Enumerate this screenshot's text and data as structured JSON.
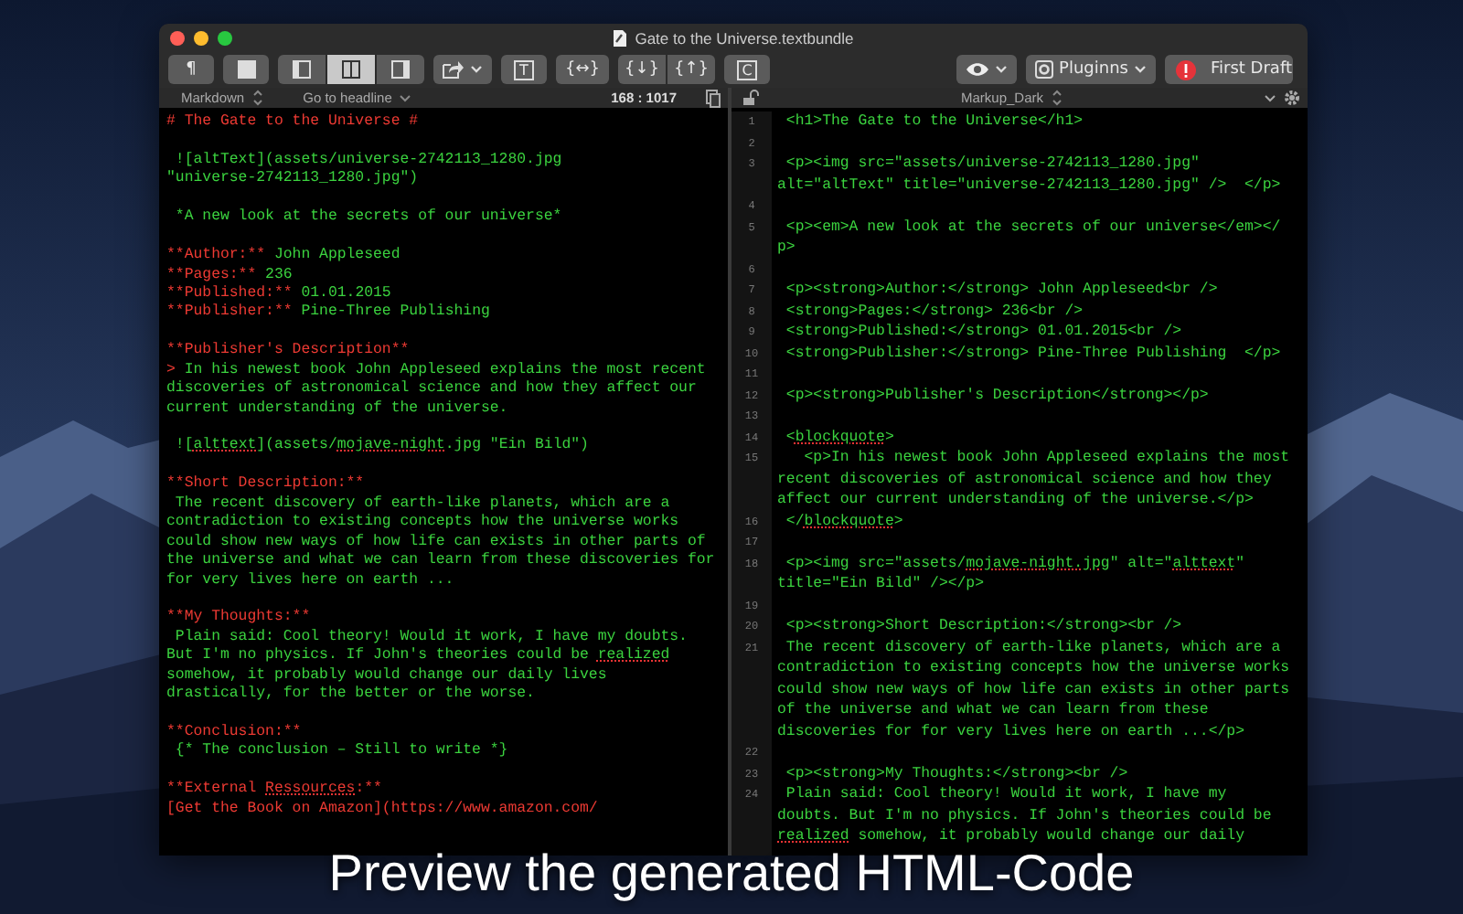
{
  "window": {
    "title": "Gate to the Universe.textbundle"
  },
  "toolbar": {
    "left": [
      {
        "kind": "text",
        "label": "¶"
      },
      {
        "kind": "single-pane"
      },
      {
        "kind": "layout",
        "options": [
          {
            "kind": "left",
            "selected": false
          },
          {
            "kind": "both",
            "selected": true
          },
          {
            "kind": "right",
            "selected": false
          }
        ]
      },
      {
        "kind": "share"
      },
      {
        "kind": "boxed",
        "label": "T"
      },
      {
        "kind": "text",
        "label": "{↔}"
      },
      {
        "kind": "pair",
        "labels": [
          "{↓}",
          "{↑}"
        ]
      },
      {
        "kind": "boxed",
        "label": "C"
      }
    ],
    "right": [
      {
        "kind": "preview"
      },
      {
        "kind": "menu",
        "label": "Pluginns"
      },
      {
        "kind": "status",
        "label": "First Draft"
      }
    ]
  },
  "left_header": {
    "mode": "Markdown",
    "navigator": "Go to headline",
    "position": "168 : 1017"
  },
  "right_header": {
    "theme": "Markup_Dark"
  },
  "editor": {
    "lines": [
      {
        "kind": "code",
        "segments": [
          {
            "kind": "markup",
            "text": "# The Gate to the Universe #"
          }
        ]
      },
      {
        "kind": "blank"
      },
      {
        "kind": "code",
        "segments": [
          {
            "kind": "text",
            "text": " ![altText](assets/universe-2742113_1280.jpg"
          }
        ]
      },
      {
        "kind": "code",
        "segments": [
          {
            "kind": "text",
            "text": "\"universe-2742113_1280.jpg\")"
          }
        ]
      },
      {
        "kind": "blank"
      },
      {
        "kind": "code",
        "segments": [
          {
            "kind": "text",
            "text": " *A new look at the secrets of our universe*"
          }
        ]
      },
      {
        "kind": "blank"
      },
      {
        "kind": "code",
        "segments": [
          {
            "kind": "markup",
            "text": "**Author:**"
          },
          {
            "kind": "text",
            "text": " John Appleseed"
          }
        ]
      },
      {
        "kind": "code",
        "segments": [
          {
            "kind": "markup",
            "text": "**Pages:**"
          },
          {
            "kind": "text",
            "text": " 236"
          }
        ]
      },
      {
        "kind": "code",
        "segments": [
          {
            "kind": "markup",
            "text": "**Published:**"
          },
          {
            "kind": "text",
            "text": " 01.01.2015"
          }
        ]
      },
      {
        "kind": "code",
        "segments": [
          {
            "kind": "markup",
            "text": "**Publisher:**"
          },
          {
            "kind": "text",
            "text": " Pine-Three Publishing"
          }
        ]
      },
      {
        "kind": "blank"
      },
      {
        "kind": "code",
        "segments": [
          {
            "kind": "markup",
            "text": "**Publisher's Description**"
          }
        ]
      },
      {
        "kind": "code",
        "segments": [
          {
            "kind": "markup",
            "text": ">"
          },
          {
            "kind": "text",
            "text": " In his newest book John Appleseed explains the most recent"
          }
        ]
      },
      {
        "kind": "code",
        "segments": [
          {
            "kind": "text",
            "text": "discoveries of astronomical science and how they affect our"
          }
        ]
      },
      {
        "kind": "code",
        "segments": [
          {
            "kind": "text",
            "text": "current understanding of the universe."
          }
        ]
      },
      {
        "kind": "blank"
      },
      {
        "kind": "code",
        "segments": [
          {
            "kind": "text",
            "text": " !["
          },
          {
            "kind": "typo",
            "text": "alttext"
          },
          {
            "kind": "text",
            "text": "](assets/"
          },
          {
            "kind": "typo",
            "text": "mojave-night"
          },
          {
            "kind": "text",
            "text": ".jpg \"Ein Bild\")"
          }
        ]
      },
      {
        "kind": "blank"
      },
      {
        "kind": "code",
        "segments": [
          {
            "kind": "markup",
            "text": "**Short Description:**"
          }
        ]
      },
      {
        "kind": "code",
        "segments": [
          {
            "kind": "text",
            "text": " The recent discovery of earth-like planets, which are a"
          }
        ]
      },
      {
        "kind": "code",
        "segments": [
          {
            "kind": "text",
            "text": "contradiction to existing concepts how the universe works"
          }
        ]
      },
      {
        "kind": "code",
        "segments": [
          {
            "kind": "text",
            "text": "could show new ways of how life can exists in other parts of"
          }
        ]
      },
      {
        "kind": "code",
        "segments": [
          {
            "kind": "text",
            "text": "the universe and what we can learn from these discoveries for"
          }
        ]
      },
      {
        "kind": "code",
        "segments": [
          {
            "kind": "text",
            "text": "for very lives here on earth ..."
          }
        ]
      },
      {
        "kind": "blank"
      },
      {
        "kind": "code",
        "segments": [
          {
            "kind": "markup",
            "text": "**My Thoughts:**"
          }
        ]
      },
      {
        "kind": "code",
        "segments": [
          {
            "kind": "text",
            "text": " Plain said: Cool theory! Would it work, I have my doubts."
          }
        ]
      },
      {
        "kind": "code",
        "segments": [
          {
            "kind": "text",
            "text": "But I'm no physics. If John's theories could be "
          },
          {
            "kind": "typo",
            "text": "realized"
          }
        ]
      },
      {
        "kind": "code",
        "segments": [
          {
            "kind": "text",
            "text": "somehow, it probably would change our daily lives"
          }
        ]
      },
      {
        "kind": "code",
        "segments": [
          {
            "kind": "text",
            "text": "drastically, for the better or the worse."
          }
        ]
      },
      {
        "kind": "blank"
      },
      {
        "kind": "code",
        "segments": [
          {
            "kind": "markup",
            "text": "**Conclusion:**"
          }
        ]
      },
      {
        "kind": "code",
        "segments": [
          {
            "kind": "text",
            "text": " {* The conclusion – Still to write *}"
          }
        ]
      },
      {
        "kind": "blank"
      },
      {
        "kind": "code",
        "segments": [
          {
            "kind": "markup",
            "text": "**External "
          },
          {
            "kind": "typo-markup",
            "text": "Ressources"
          },
          {
            "kind": "markup",
            "text": ":**"
          }
        ]
      },
      {
        "kind": "code",
        "segments": [
          {
            "kind": "markup",
            "text": "[Get the Book on Amazon](https://www.amazon.com/"
          }
        ]
      }
    ]
  },
  "preview": {
    "lines": [
      {
        "number": "1",
        "rows": [
          " <h1>The Gate to the Universe</h1>"
        ]
      },
      {
        "number": "2"
      },
      {
        "number": "3",
        "rows": [
          " <p><img src=\"assets/universe-2742113_1280.jpg\"",
          "alt=\"altText\" title=\"universe-2742113_1280.jpg\" />  </p>"
        ]
      },
      {
        "number": "4"
      },
      {
        "number": "5",
        "rows": [
          " <p><em>A new look at the secrets of our universe</em></",
          "p>"
        ]
      },
      {
        "number": "6"
      },
      {
        "number": "7",
        "rows": [
          " <p><strong>Author:</strong> John Appleseed<br />"
        ]
      },
      {
        "number": "8",
        "rows": [
          " <strong>Pages:</strong> 236<br />"
        ]
      },
      {
        "number": "9",
        "rows": [
          " <strong>Published:</strong> 01.01.2015<br />"
        ]
      },
      {
        "number": "10",
        "rows": [
          " <strong>Publisher:</strong> Pine-Three Publishing  </p>"
        ]
      },
      {
        "number": "11"
      },
      {
        "number": "12",
        "rows": [
          " <p><strong>Publisher's Description</strong></p>"
        ]
      },
      {
        "number": "13"
      },
      {
        "number": "14",
        "rows": [
          [
            {
              "kind": "text",
              "text": " <"
            },
            {
              "kind": "typo",
              "text": "blockquote"
            },
            {
              "kind": "text",
              "text": ">"
            }
          ]
        ]
      },
      {
        "number": "15",
        "rows": [
          "   <p>In his newest book John Appleseed explains the most",
          "recent discoveries of astronomical science and how they",
          "affect our current understanding of the universe.</p>"
        ]
      },
      {
        "number": "16",
        "rows": [
          [
            {
              "kind": "text",
              "text": " </"
            },
            {
              "kind": "typo",
              "text": "blockquote"
            },
            {
              "kind": "text",
              "text": ">"
            }
          ]
        ]
      },
      {
        "number": "17"
      },
      {
        "number": "18",
        "rows": [
          [
            {
              "kind": "text",
              "text": " <p><img src=\"assets/"
            },
            {
              "kind": "typo",
              "text": "mojave-night.jpg"
            },
            {
              "kind": "text",
              "text": "\" alt=\""
            },
            {
              "kind": "typo",
              "text": "alttext"
            },
            {
              "kind": "text",
              "text": "\""
            }
          ],
          "title=\"Ein Bild\" /></p>"
        ]
      },
      {
        "number": "19"
      },
      {
        "number": "20",
        "rows": [
          " <p><strong>Short Description:</strong><br />"
        ]
      },
      {
        "number": "21",
        "rows": [
          " The recent discovery of earth-like planets, which are a",
          "contradiction to existing concepts how the universe works",
          "could show new ways of how life can exists in other parts",
          "of the universe and what we can learn from these",
          "discoveries for for very lives here on earth ...</p>"
        ]
      },
      {
        "number": "22"
      },
      {
        "number": "23",
        "rows": [
          " <p><strong>My Thoughts:</strong><br />"
        ]
      },
      {
        "number": "24",
        "rows": [
          " Plain said: Cool theory! Would it work, I have my",
          "doubts. But I'm no physics. If John's theories could be",
          [
            {
              "kind": "typo",
              "text": "realized"
            },
            {
              "kind": "text",
              "text": " somehow, it probably would change our daily"
            }
          ]
        ]
      }
    ]
  },
  "caption": "Preview the generated HTML-Code"
}
